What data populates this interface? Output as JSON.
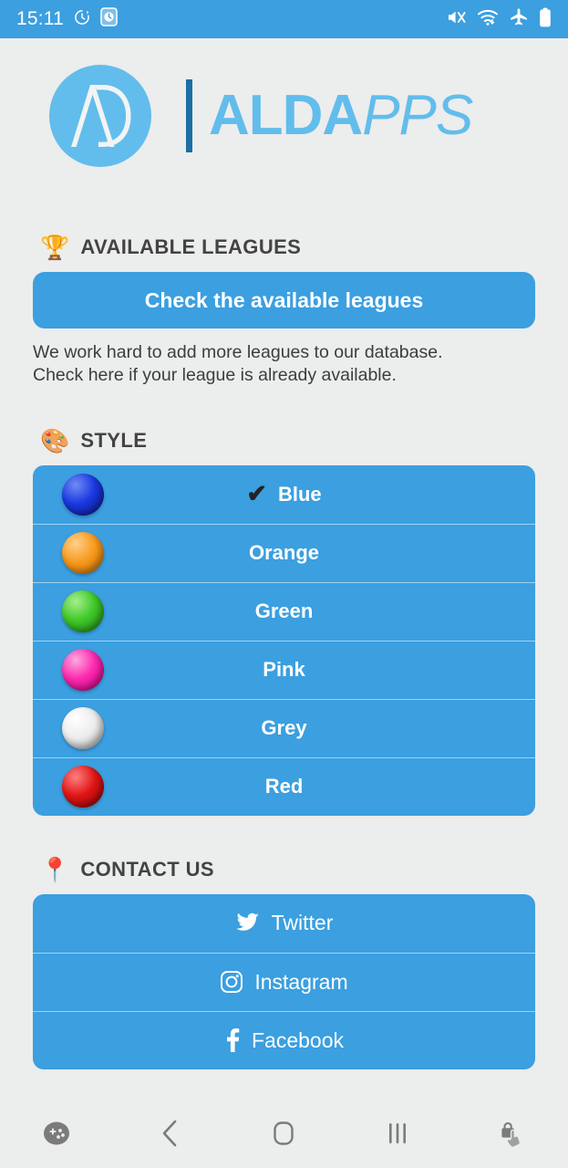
{
  "statusbar": {
    "time": "15:11",
    "left_icons": [
      "alarm-icon",
      "clock-widget-icon"
    ],
    "right_icons": [
      "mute-icon",
      "wifi-download-icon",
      "airplane-mode-icon",
      "battery-icon"
    ],
    "background": "#3b9fe0"
  },
  "header": {
    "logo_mark": "aldapps-ad-monogram-icon",
    "brand_bold": "ALDA",
    "brand_italic": "PPS",
    "brand_color": "#62bdec",
    "divider_color": "#1c6ea4"
  },
  "leagues": {
    "emoji": "🏆",
    "emoji_name": "trophy-icon",
    "title": "AVAILABLE LEAGUES",
    "button_label": "Check the available leagues",
    "note_line1": "We work hard to add more leagues to our database.",
    "note_line2": "Check here if your league is already available."
  },
  "style": {
    "emoji": "🎨",
    "emoji_name": "palette-icon",
    "title": "STYLE",
    "selected": "Blue",
    "check_glyph": "✔",
    "options": [
      {
        "label": "Blue",
        "swatch_name": "blue-sphere-icon",
        "color": "#1a38e0",
        "light": "#6f8cf5",
        "dark": "#0a1a8c",
        "selected": true
      },
      {
        "label": "Orange",
        "swatch_name": "orange-sphere-icon",
        "color": "#f79a1e",
        "light": "#ffd08a",
        "dark": "#d06e00",
        "selected": false
      },
      {
        "label": "Green",
        "swatch_name": "green-sphere-icon",
        "color": "#3fc728",
        "light": "#a7ef8d",
        "dark": "#1f8a10",
        "selected": false
      },
      {
        "label": "Pink",
        "swatch_name": "pink-sphere-icon",
        "color": "#fb29ae",
        "light": "#ffa8e0",
        "dark": "#c3007f",
        "selected": false
      },
      {
        "label": "Grey",
        "swatch_name": "grey-sphere-icon",
        "color": "#ededed",
        "light": "#ffffff",
        "dark": "#aaaaaa",
        "selected": false
      },
      {
        "label": "Red",
        "swatch_name": "red-sphere-icon",
        "color": "#e01515",
        "light": "#ff8080",
        "dark": "#8d0404",
        "selected": false
      }
    ]
  },
  "contact": {
    "emoji": "📍",
    "emoji_name": "pushpin-icon",
    "title": "CONTACT US",
    "links": [
      {
        "label": "Twitter",
        "icon": "twitter-icon"
      },
      {
        "label": "Instagram",
        "icon": "instagram-icon"
      },
      {
        "label": "Facebook",
        "icon": "facebook-icon"
      }
    ]
  },
  "navbar": {
    "items": [
      {
        "name": "game-booster-icon"
      },
      {
        "name": "back-icon"
      },
      {
        "name": "home-icon"
      },
      {
        "name": "recents-icon"
      },
      {
        "name": "lock-pointer-icon"
      }
    ],
    "icon_color": "#7b7b7b"
  },
  "theme": {
    "page_background": "#eceded",
    "accent": "#3b9fe0",
    "separator": "#9fd2f0",
    "heading_text": "#434343"
  }
}
